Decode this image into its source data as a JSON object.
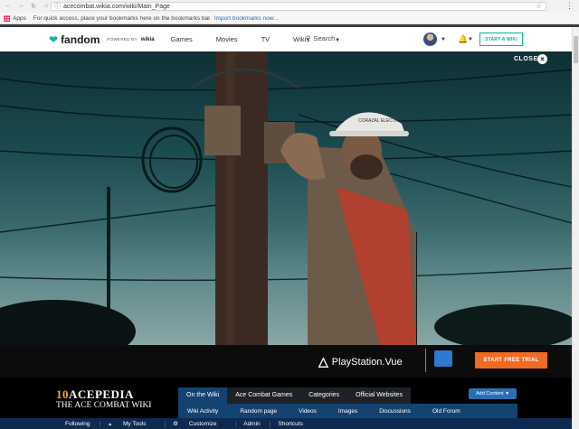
{
  "browser": {
    "url": "acecombat.wikia.com/wiki/Main_Page",
    "apps_label": "Apps",
    "bookmarks_hint": "For quick access, place your bookmarks here on the bookmarks bar.",
    "import_link": "Import bookmarks now..."
  },
  "fandom": {
    "brand": "fandom",
    "powered": "POWERED BY",
    "wikia": "wikia",
    "nav": [
      "Games",
      "Movies",
      "TV",
      "Wikis"
    ],
    "search_label": "Search",
    "start_wiki": "START A WIKI"
  },
  "video": {
    "close_label": "CLOSE",
    "close_x": "×",
    "helmet_text": "CORAZAL ELECTRIC"
  },
  "ad": {
    "brand": "PlayStation.Vue",
    "cta": "START FREE TRIAL"
  },
  "wiki": {
    "logo_number": "10",
    "logo_title": "ACEPEDIA",
    "logo_subtitle": "THE ACE COMBAT WIKI",
    "tabs": [
      "On the Wiki",
      "Ace Combat Games",
      "Categories",
      "Official Websites"
    ],
    "subnav": [
      "Wiki Activity",
      "Random page",
      "Videos",
      "Images",
      "Discussions",
      "Old Forum"
    ],
    "add_content": "Add Content"
  },
  "toolbar": {
    "items": [
      "Following",
      "My Tools",
      "Customize",
      "Admin",
      "Shortcuts"
    ]
  }
}
